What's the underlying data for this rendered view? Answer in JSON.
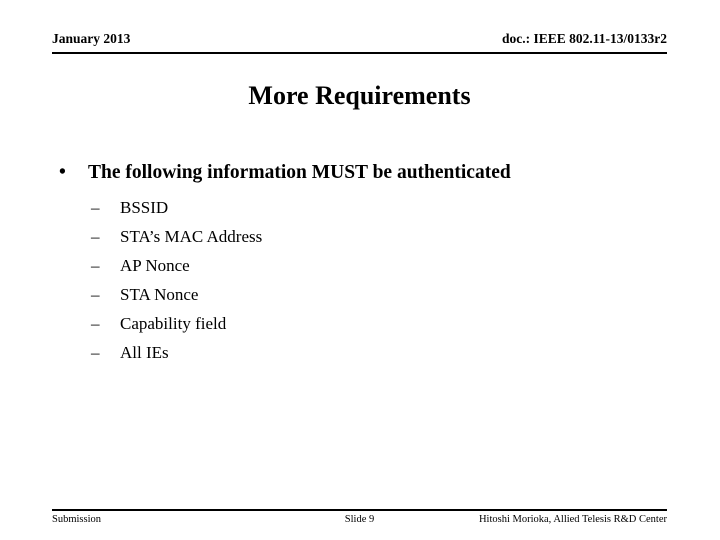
{
  "header": {
    "left": "January 2013",
    "right": "doc.: IEEE 802.11-13/0133r2"
  },
  "title": "More Requirements",
  "content": {
    "bullet_marker": "•",
    "sub_marker": "–",
    "main_bullet": "The following information MUST be authenticated",
    "sub_bullets": [
      "BSSID",
      "STA’s MAC Address",
      "AP Nonce",
      "STA Nonce",
      "Capability field",
      "All IEs"
    ]
  },
  "footer": {
    "left": "Submission",
    "center": "Slide 9",
    "right": "Hitoshi Morioka, Allied Telesis R&D Center"
  },
  "colors": {
    "background": "#ffffff",
    "text": "#000000",
    "rule": "#000000"
  }
}
